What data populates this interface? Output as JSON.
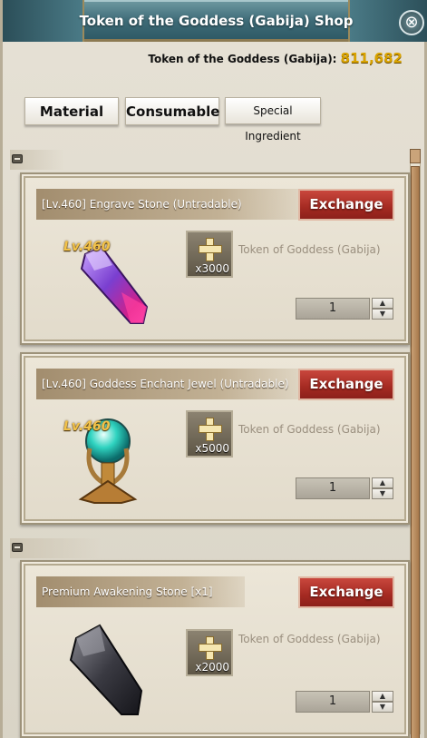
{
  "window": {
    "title": "Token of the Goddess (Gabija) Shop",
    "close_glyph": "⊗"
  },
  "currency": {
    "label": "Token of the Goddess (Gabija):",
    "amount": "811,682"
  },
  "tabs": [
    {
      "label": "Material"
    },
    {
      "label": "Consumable"
    },
    {
      "label": "Special Ingredient"
    }
  ],
  "items": [
    {
      "name": "[Lv.460] Engrave Stone (Untradable)",
      "button": "Exchange",
      "level_badge": "Lv.460",
      "icon": "engrave-stone-crystal",
      "cost_qty": "x3000",
      "cost_label": "Token of Goddess (Gabija)",
      "quantity": "1"
    },
    {
      "name": "[Lv.460] Goddess Enchant Jewel (Untradable)",
      "button": "Exchange",
      "level_badge": "Lv.460",
      "icon": "enchant-jewel-orb",
      "cost_qty": "x5000",
      "cost_label": "Token of Goddess (Gabija)",
      "quantity": "1"
    },
    {
      "name": "Premium Awakening Stone [x1]",
      "button": "Exchange",
      "level_badge": "",
      "icon": "awakening-stone",
      "cost_qty": "x2000",
      "cost_label": "Token of Goddess (Gabija)",
      "quantity": "1"
    }
  ],
  "icons": {
    "stepper_up": "▲",
    "stepper_down": "▼"
  },
  "colors": {
    "titlebar": "#3d6a76",
    "exchange_button": "#a52a22",
    "currency_amount": "#d9a300",
    "level_badge": "#f2c24a"
  }
}
